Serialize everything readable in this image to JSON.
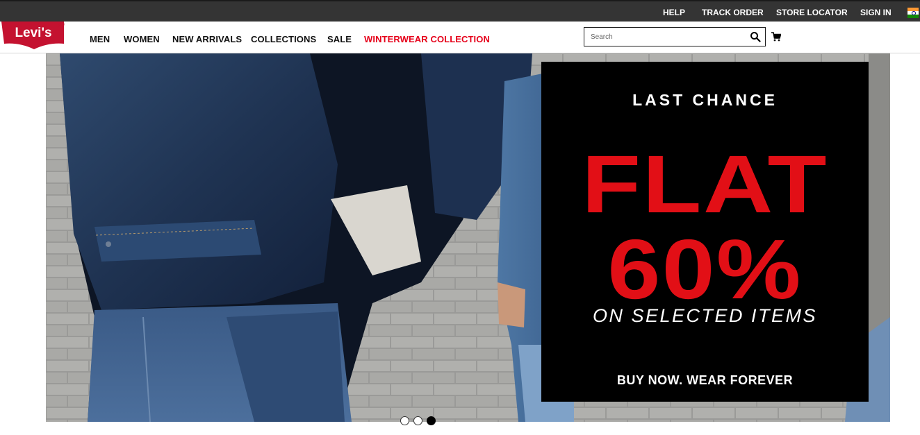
{
  "topbar": {
    "links": [
      "HELP",
      "TRACK ORDER",
      "STORE LOCATOR",
      "SIGN IN"
    ],
    "region_icon": "india-flag-icon"
  },
  "header": {
    "logo_text": "Levi's",
    "logo_mark": "®",
    "nav": [
      {
        "label": "MEN",
        "highlight": false
      },
      {
        "label": "WOMEN",
        "highlight": false
      },
      {
        "label": "NEW ARRIVALS",
        "highlight": false
      },
      {
        "label": "COLLECTIONS",
        "highlight": false
      },
      {
        "label": "SALE",
        "highlight": false
      },
      {
        "label": "WINTERWEAR COLLECTION",
        "highlight": true
      }
    ],
    "search": {
      "placeholder": "Search",
      "value": "",
      "icon": "search-icon"
    },
    "cart_icon": "cart-icon"
  },
  "hero": {
    "promo": {
      "kicker": "LAST CHANCE",
      "headline_1": "FLAT",
      "headline_2": "60%",
      "subline": "ON SELECTED ITEMS",
      "cta": "BUY NOW. WEAR FOREVER"
    },
    "carousel": {
      "slides": 3,
      "active": 3
    }
  },
  "colors": {
    "topbar_bg": "#343434",
    "accent_red": "#e20f16",
    "highlight_nav": "#e6001a",
    "promo_bg": "#000000"
  }
}
